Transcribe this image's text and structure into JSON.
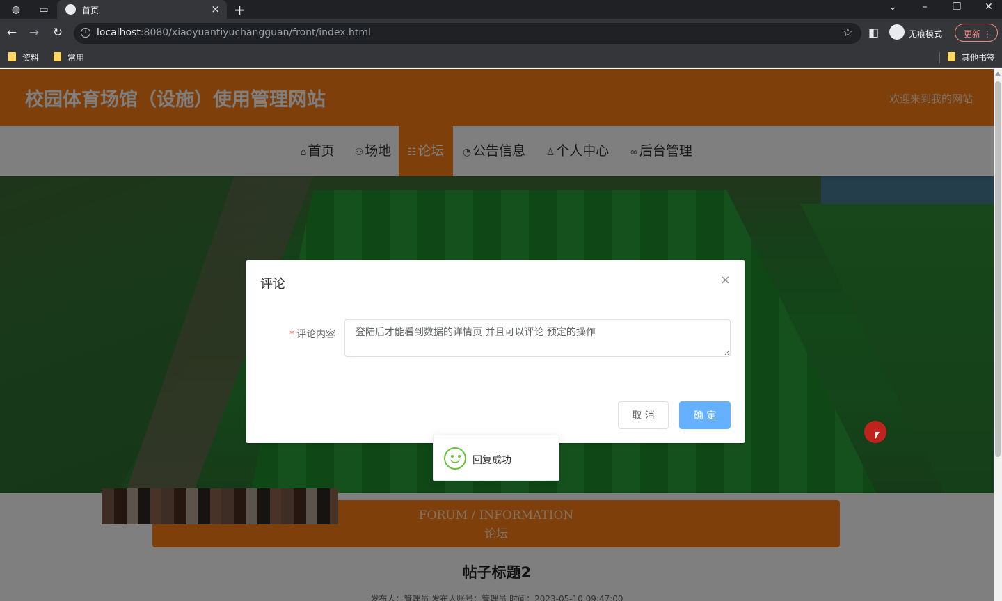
{
  "browser": {
    "tab_title": "首页",
    "url_host": "localhost",
    "url_rest": ":8080/xiaoyuantiyuchangguan/front/index.html",
    "incognito_label": "无痕模式",
    "update_label": "更新",
    "bookmarks": [
      "资料",
      "常用"
    ],
    "other_bookmarks": "其他书签"
  },
  "site": {
    "title": "校园体育场馆（设施）使用管理网站",
    "welcome": "欢迎来到我的网站"
  },
  "nav": [
    {
      "icon": "⌂",
      "label": "首页"
    },
    {
      "icon": "⚇",
      "label": "场地"
    },
    {
      "icon": "☷",
      "label": "论坛"
    },
    {
      "icon": "◔",
      "label": "公告信息"
    },
    {
      "icon": "♙",
      "label": "个人中心"
    },
    {
      "icon": "∞",
      "label": "后台管理"
    }
  ],
  "forum": {
    "en": "FORUM / INFORMATION",
    "cn": "论坛",
    "post_title": "帖子标题2",
    "post_meta": "发布人：管理员  发布人账号：管理员  时间：2023-05-10 09:47:00"
  },
  "dialog": {
    "title": "评论",
    "close": "×",
    "required_mark": "*",
    "field_label": "评论内容",
    "field_value": "登陆后才能看到数据的详情页 并且可以评论 预定的操作",
    "cancel": "取 消",
    "confirm": "确 定"
  },
  "toast": {
    "message": "回复成功"
  },
  "colors": {
    "brand": "#fc7f14",
    "primary_light": "#66b1ff",
    "success": "#67c23a"
  }
}
